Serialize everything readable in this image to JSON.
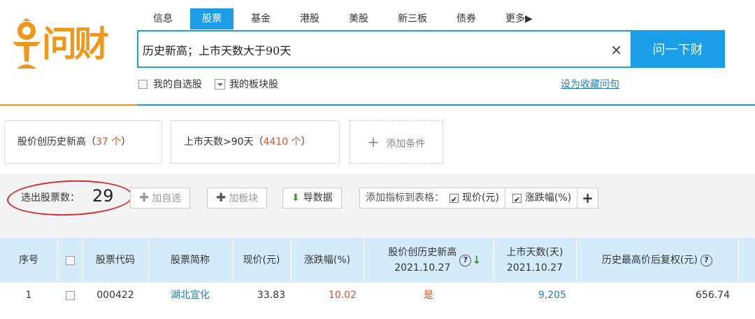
{
  "logo": {
    "text": "问财",
    "color": "#f19717"
  },
  "nav": {
    "items": [
      "信息",
      "股票",
      "基金",
      "港股",
      "美股",
      "新三板",
      "债券",
      "更多▶"
    ],
    "active_index": 1
  },
  "search": {
    "query": "历史新高；上市天数大于90天",
    "clear_icon": "×",
    "button_label": "问一下财"
  },
  "options": {
    "my_watchlist": "我的自选股",
    "my_sector": "我的板块股",
    "save_query": "设为收藏问句"
  },
  "conditions": [
    {
      "label": "股价创历史新高（",
      "count": "37 个",
      "tail": "）"
    },
    {
      "label": "上市天数>90天（",
      "count": "4410 个",
      "tail": "）"
    }
  ],
  "add_condition": {
    "icon": "+",
    "label": "添加条件"
  },
  "toolbar": {
    "count_label": "选出股票数：",
    "count_value": "29",
    "add_watchlist": "加自选",
    "add_sector": "加板块",
    "export": "导数据",
    "add_metric_label": "添加指标到表格：",
    "metric_price": "现价(元)",
    "metric_change": "涨跌幅(%)",
    "add_metric_plus": "+"
  },
  "table": {
    "headers": {
      "index": "序号",
      "code": "股票代码",
      "name": "股票简称",
      "price": "现价(元)",
      "change": "涨跌幅(%)",
      "new_high": "股价创历史新高",
      "new_high_date": "2021.10.27",
      "list_days": "上市天数(天)",
      "list_days_date": "2021.10.27",
      "hist_high": "历史最高价后复权(元)"
    },
    "rows": [
      {
        "index": "1",
        "code": "000422",
        "name": "湖北宜化",
        "price": "33.83",
        "change": "10.02",
        "new_high": "是",
        "list_days": "9,205",
        "hist_high": "656.74"
      }
    ]
  }
}
